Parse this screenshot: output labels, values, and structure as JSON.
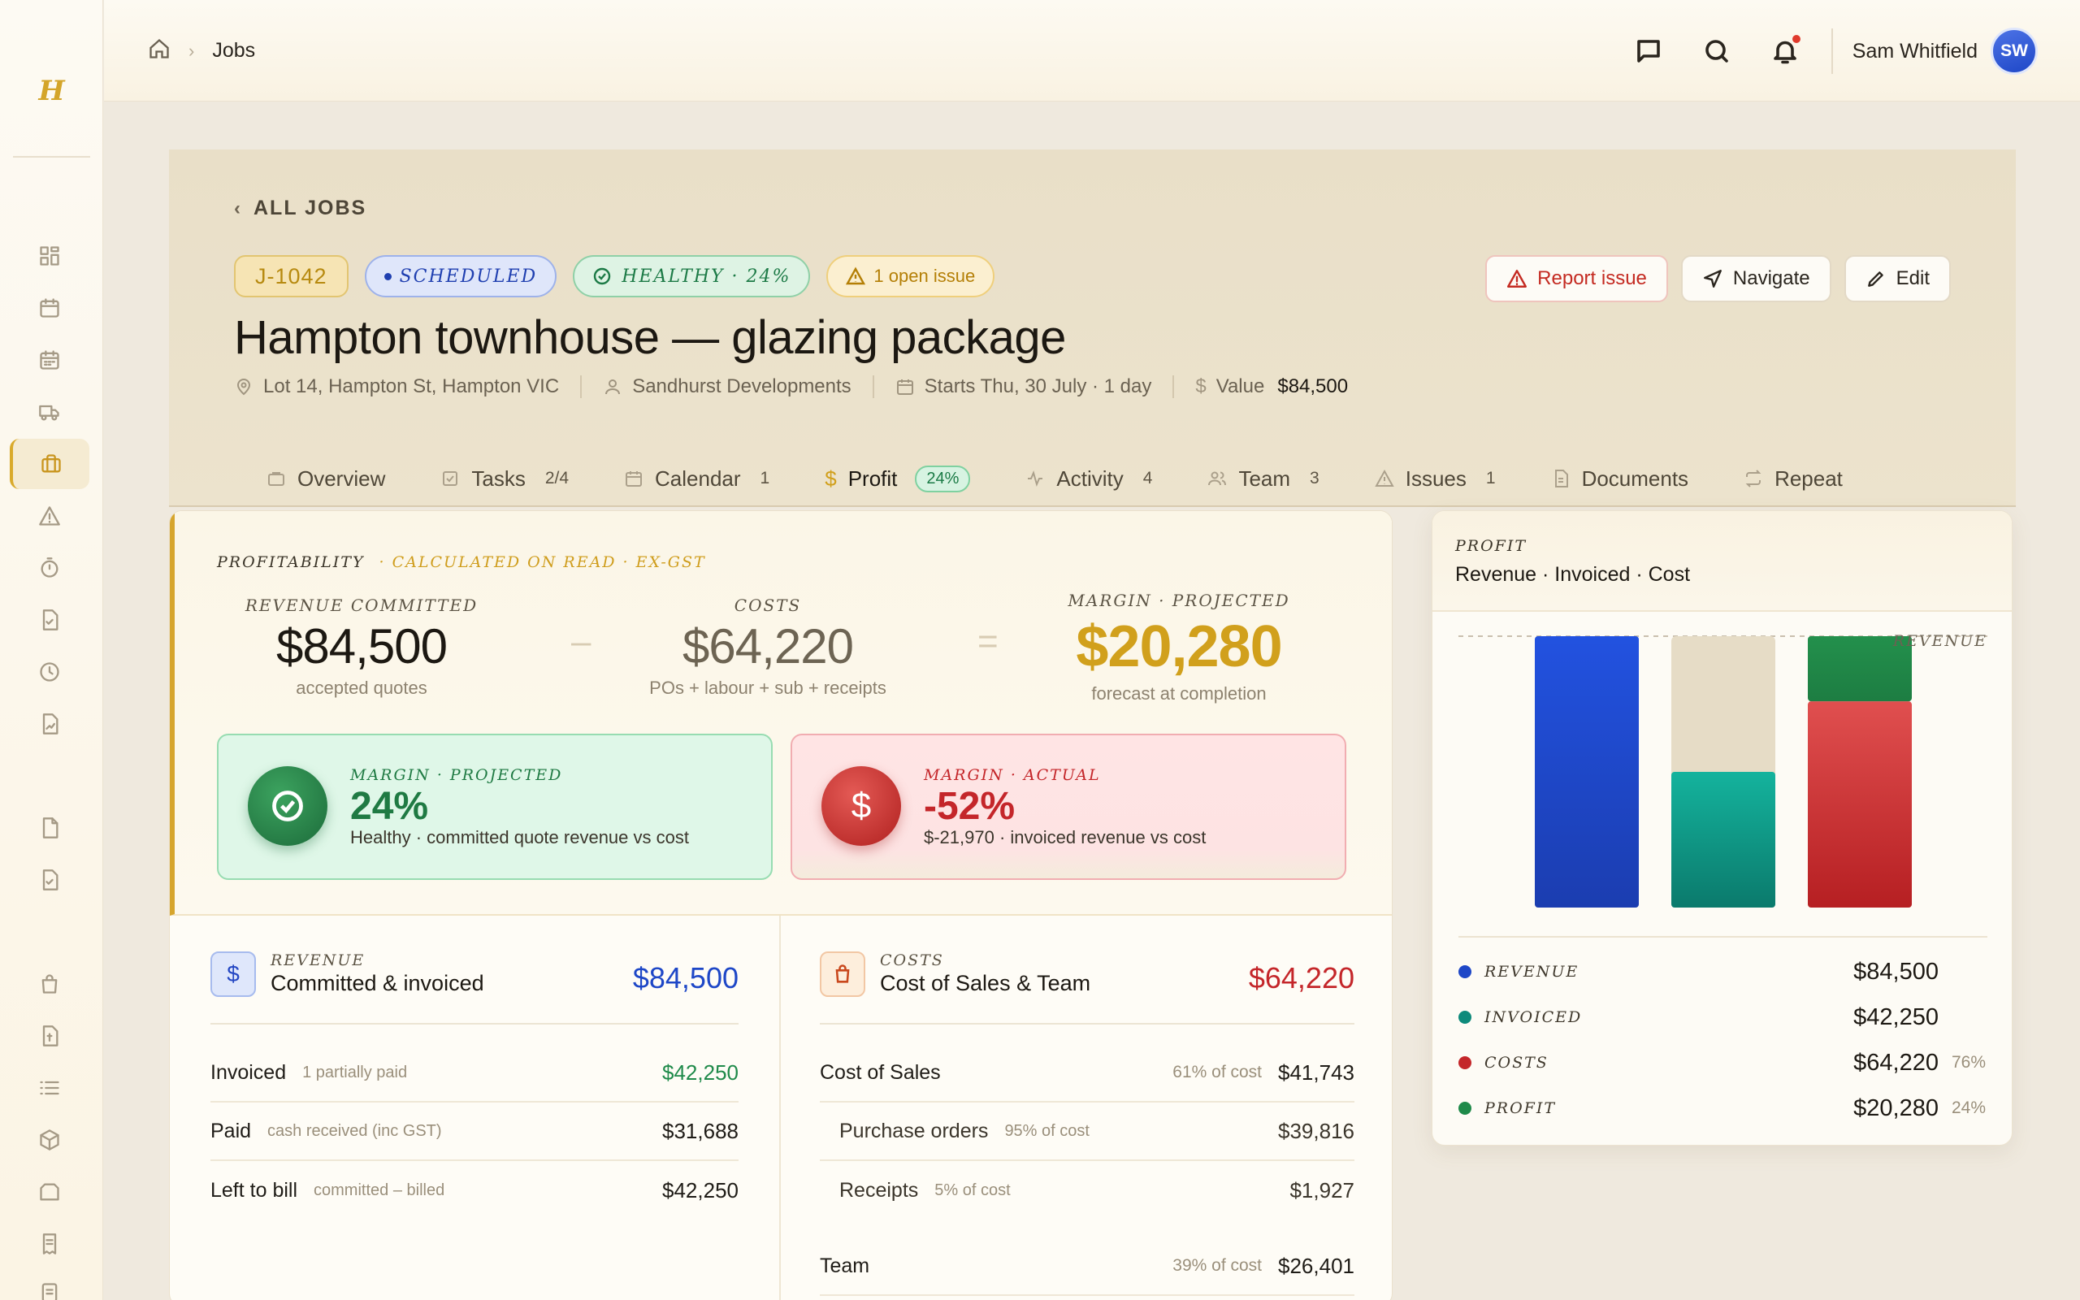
{
  "app": {
    "logo_letter": "H"
  },
  "sidebar": {
    "icons": [
      "dashboard-icon",
      "calendar-icon",
      "schedule-icon",
      "truck-icon",
      "briefcase-icon",
      "warning-icon",
      "timer-icon",
      "checklist-icon",
      "clock-icon",
      "document-chart-icon",
      "file-icon",
      "file-check-icon",
      "bag-icon",
      "invoice-icon",
      "list-icon",
      "box-icon",
      "folder-icon",
      "receipt-icon",
      "report-icon"
    ],
    "active": "briefcase-icon"
  },
  "topbar": {
    "breadcrumb": {
      "current": "Jobs"
    },
    "user": {
      "name": "Sam Whitfield",
      "initials": "SW"
    }
  },
  "job": {
    "back_label": "ALL JOBS",
    "id": "J-1042",
    "status": "SCHEDULED",
    "health": "HEALTHY · 24%",
    "issue_badge": "1 open issue",
    "title": "Hampton townhouse — glazing package",
    "address": "Lot 14, Hampton St, Hampton VIC",
    "client": "Sandhurst Developments",
    "starts": "Starts Thu, 30 July · 1 day",
    "value_label": "Value",
    "value": "$84,500",
    "actions": {
      "report": "Report issue",
      "navigate": "Navigate",
      "edit": "Edit"
    }
  },
  "tabs": [
    {
      "label": "Overview",
      "count": ""
    },
    {
      "label": "Tasks",
      "count": "2/4"
    },
    {
      "label": "Calendar",
      "count": "1"
    },
    {
      "label": "Profit",
      "count": "24%"
    },
    {
      "label": "Activity",
      "count": "4"
    },
    {
      "label": "Team",
      "count": "3"
    },
    {
      "label": "Issues",
      "count": "1"
    },
    {
      "label": "Documents",
      "count": ""
    },
    {
      "label": "Repeat",
      "count": ""
    }
  ],
  "profitability": {
    "label": "PROFITABILITY",
    "sublabel": "· CALCULATED ON READ · EX-GST",
    "revenue": {
      "label": "REVENUE COMMITTED",
      "value": "$84,500",
      "sub": "accepted quotes"
    },
    "minus": "–",
    "costs": {
      "label": "COSTS",
      "value": "$64,220",
      "sub": "POs + labour + sub + receipts"
    },
    "equals": "=",
    "margin": {
      "label": "MARGIN · PROJECTED",
      "value": "$20,280",
      "sub": "forecast at completion"
    },
    "projected": {
      "label": "MARGIN · PROJECTED",
      "value": "24%",
      "desc": "Healthy · committed quote revenue vs cost"
    },
    "actual": {
      "label": "MARGIN · ACTUAL",
      "value": "-52%",
      "desc": "$-21,970 · invoiced revenue vs cost"
    }
  },
  "revenue_panel": {
    "label": "REVENUE",
    "title": "Committed & invoiced",
    "total": "$84,500",
    "rows": [
      {
        "name": "Invoiced",
        "note": "1 partially paid",
        "amount": "$42,250"
      },
      {
        "name": "Paid",
        "note": "cash received (inc GST)",
        "amount": "$31,688"
      },
      {
        "name": "Left to bill",
        "note": "committed – billed",
        "amount": "$42,250"
      }
    ]
  },
  "costs_panel": {
    "label": "COSTS",
    "title": "Cost of Sales & Team",
    "total": "$64,220",
    "rows": [
      {
        "name": "Cost of Sales",
        "pct": "61% of cost",
        "amount": "$41,743"
      },
      {
        "name": "Purchase orders",
        "pct": "95% of cost",
        "amount": "$39,816"
      },
      {
        "name": "Receipts",
        "pct": "5% of cost",
        "amount": "$1,927"
      },
      {
        "name": "Team",
        "pct": "39% of cost",
        "amount": "$26,401"
      }
    ]
  },
  "profit_chart": {
    "label": "PROFIT",
    "title": "Revenue · Invoiced · Cost",
    "reference_label": "REVENUE",
    "legend": [
      {
        "name": "REVENUE",
        "value": "$84,500",
        "pct": ""
      },
      {
        "name": "INVOICED",
        "value": "$42,250",
        "pct": ""
      },
      {
        "name": "COSTS",
        "value": "$64,220",
        "pct": "76%"
      },
      {
        "name": "PROFIT",
        "value": "$20,280",
        "pct": "24%"
      }
    ]
  },
  "colors": {
    "accent": "#d1a01c",
    "revenue": "#1e47c7",
    "invoiced": "#0e8a7b",
    "costs": "#c4262a",
    "profit": "#1f8a4a"
  },
  "chart_data": {
    "type": "bar",
    "categories": [
      "Revenue",
      "Invoiced",
      "Cost"
    ],
    "title": "Revenue · Invoiced · Cost",
    "reference_line": {
      "label": "REVENUE",
      "value": 84500
    },
    "ylim": [
      0,
      84500
    ],
    "series": [
      {
        "name": "REVENUE",
        "values": [
          84500,
          0,
          0
        ]
      },
      {
        "name": "INVOICED",
        "values": [
          0,
          42250,
          0
        ]
      },
      {
        "name": "COSTS",
        "values": [
          0,
          0,
          64220
        ]
      },
      {
        "name": "PROFIT",
        "values": [
          0,
          0,
          20280
        ]
      }
    ]
  }
}
